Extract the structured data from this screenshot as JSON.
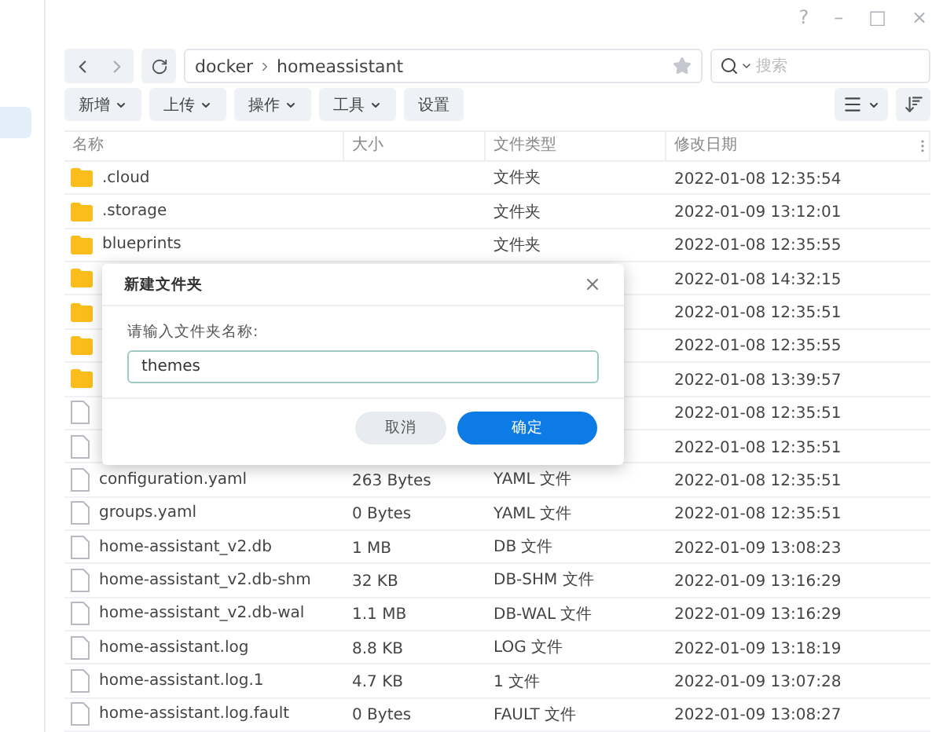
{
  "window_controls": [
    "?",
    "–",
    "□",
    "×"
  ],
  "sidebar": {
    "items": [
      {
        "selected": true
      }
    ]
  },
  "path": {
    "segments": [
      "docker",
      "homeassistant"
    ],
    "favorite": false
  },
  "search": {
    "placeholder": "搜索"
  },
  "toolbar": [
    {
      "label": "新增",
      "dropdown": true
    },
    {
      "label": "上传",
      "dropdown": true
    },
    {
      "label": "操作",
      "dropdown": true
    },
    {
      "label": "工具",
      "dropdown": true
    },
    {
      "label": "设置",
      "dropdown": false
    }
  ],
  "table": {
    "columns": [
      "名称",
      "大小",
      "文件类型",
      "修改日期"
    ],
    "rows": [
      {
        "kind": "folder",
        "name": ".cloud",
        "type": "文件夹",
        "date": "2022-01-08 12:35:54"
      },
      {
        "kind": "folder",
        "name": ".storage",
        "type": "文件夹",
        "date": "2022-01-09 13:12:01"
      },
      {
        "kind": "folder",
        "name": "blueprints",
        "type": "文件夹",
        "date": "2022-01-08 12:35:55"
      },
      {
        "kind": "folder",
        "date": "2022-01-08 14:32:15"
      },
      {
        "kind": "folder",
        "date": "2022-01-08 12:35:51"
      },
      {
        "kind": "folder",
        "date": "2022-01-08 12:35:55"
      },
      {
        "kind": "folder",
        "date": "2022-01-08 13:39:57"
      },
      {
        "kind": "file",
        "date": "2022-01-08 12:35:51"
      },
      {
        "kind": "file",
        "date": "2022-01-08 12:35:51"
      },
      {
        "kind": "file",
        "name": "configuration.yaml",
        "size": "263 Bytes",
        "type": "YAML 文件",
        "date": "2022-01-08 12:35:51"
      },
      {
        "kind": "file",
        "name": "groups.yaml",
        "size": "0 Bytes",
        "type": "YAML 文件",
        "date": "2022-01-08 12:35:51"
      },
      {
        "kind": "file",
        "name": "home-assistant_v2.db",
        "size": "1 MB",
        "type": "DB 文件",
        "date": "2022-01-09 13:08:23"
      },
      {
        "kind": "file",
        "name": "home-assistant_v2.db-shm",
        "size": "32 KB",
        "type": "DB-SHM 文件",
        "date": "2022-01-09 13:16:29"
      },
      {
        "kind": "file",
        "name": "home-assistant_v2.db-wal",
        "size": "1.1 MB",
        "type": "DB-WAL 文件",
        "date": "2022-01-09 13:16:29"
      },
      {
        "kind": "file",
        "name": "home-assistant.log",
        "size": "8.8 KB",
        "type": "LOG 文件",
        "date": "2022-01-09 13:18:19"
      },
      {
        "kind": "file",
        "name": "home-assistant.log.1",
        "size": "4.7 KB",
        "type": "1 文件",
        "date": "2022-01-09 13:07:28"
      },
      {
        "kind": "file",
        "name": "home-assistant.log.fault",
        "size": "0 Bytes",
        "type": "FAULT 文件",
        "date": "2022-01-09 13:08:27"
      }
    ]
  },
  "dialog": {
    "title": "新建文件夹",
    "label": "请输入文件夹名称:",
    "value": "themes",
    "buttons": [
      {
        "label": "取消",
        "primary": false
      },
      {
        "label": "确定",
        "primary": true
      }
    ]
  }
}
